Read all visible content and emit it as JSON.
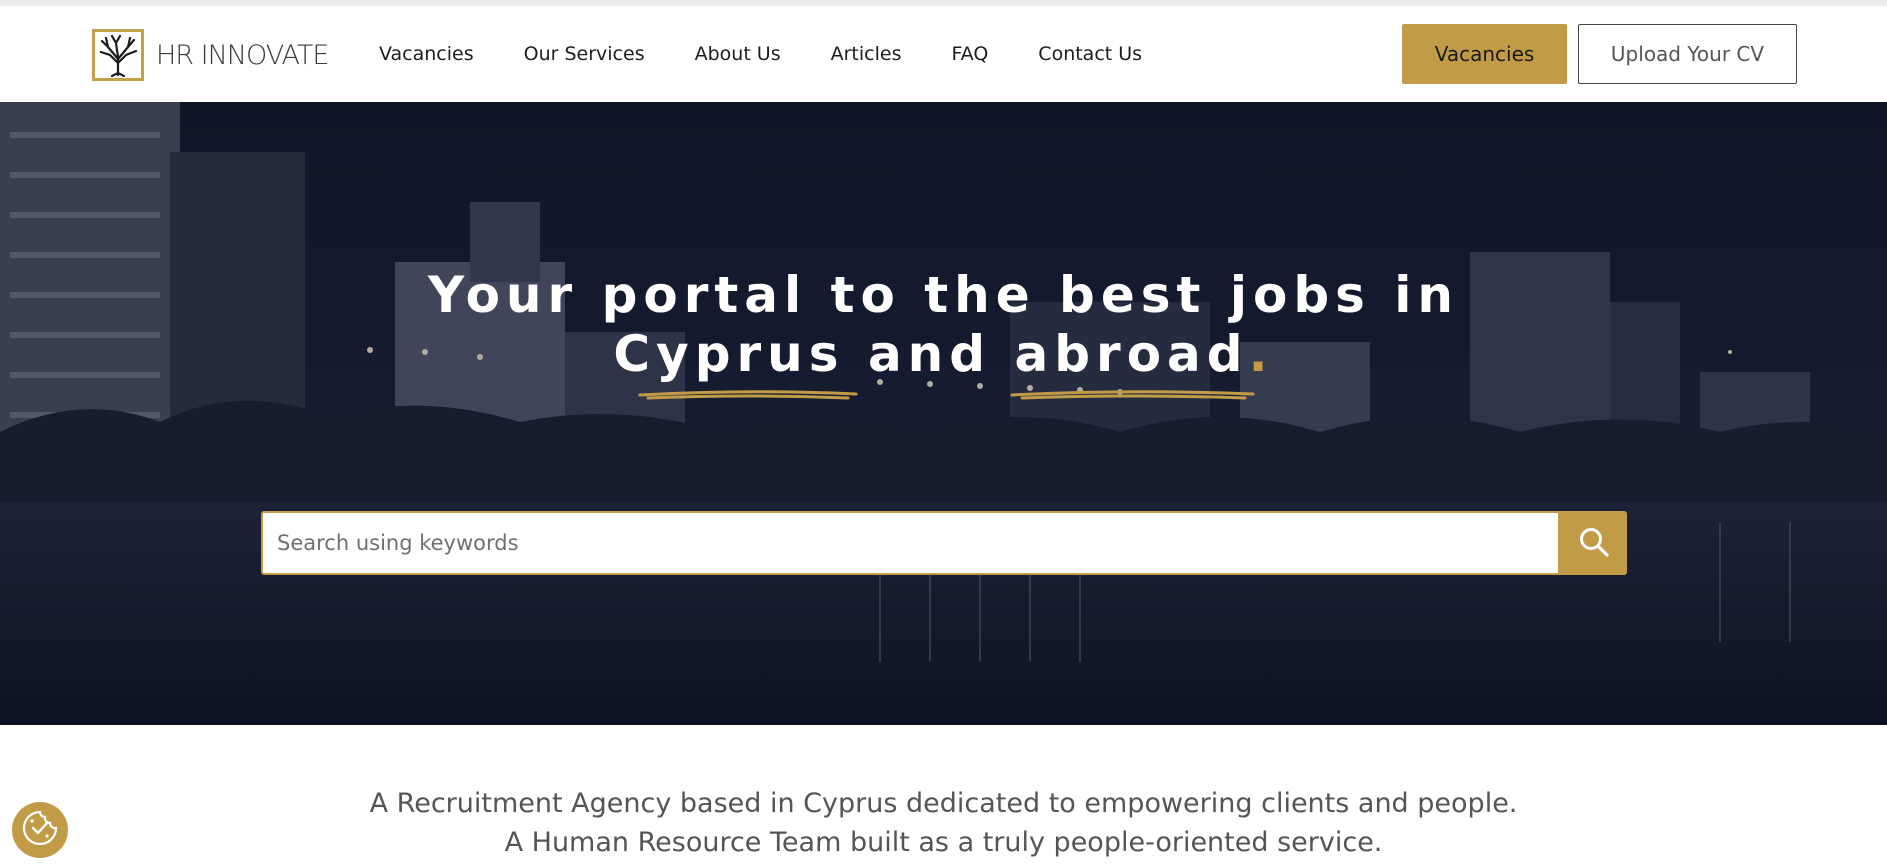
{
  "brand": {
    "name": "HR INNOVATE",
    "logo_icon": "tree-icon",
    "accent": "#c29b47",
    "dark": "#14192c"
  },
  "nav": {
    "items": [
      {
        "label": "Vacancies"
      },
      {
        "label": "Our Services"
      },
      {
        "label": "About Us"
      },
      {
        "label": "Articles"
      },
      {
        "label": "FAQ"
      },
      {
        "label": "Contact Us"
      }
    ]
  },
  "header_buttons": {
    "vacancies": "Vacancies",
    "upload_cv": "Upload Your CV"
  },
  "hero": {
    "headline_line1": "Your portal to the best jobs in",
    "headline_word1": "Cyprus",
    "headline_and": "and",
    "headline_word2": "abroad",
    "headline_dot": ".",
    "search_placeholder": "Search using keywords",
    "search_icon": "search-icon"
  },
  "intro": {
    "line1": "A Recruitment Agency based in Cyprus dedicated to empowering clients and people.",
    "line2": "A Human Resource Team built as a truly people-oriented service."
  },
  "cookie_icon": "cookie-settings-icon"
}
